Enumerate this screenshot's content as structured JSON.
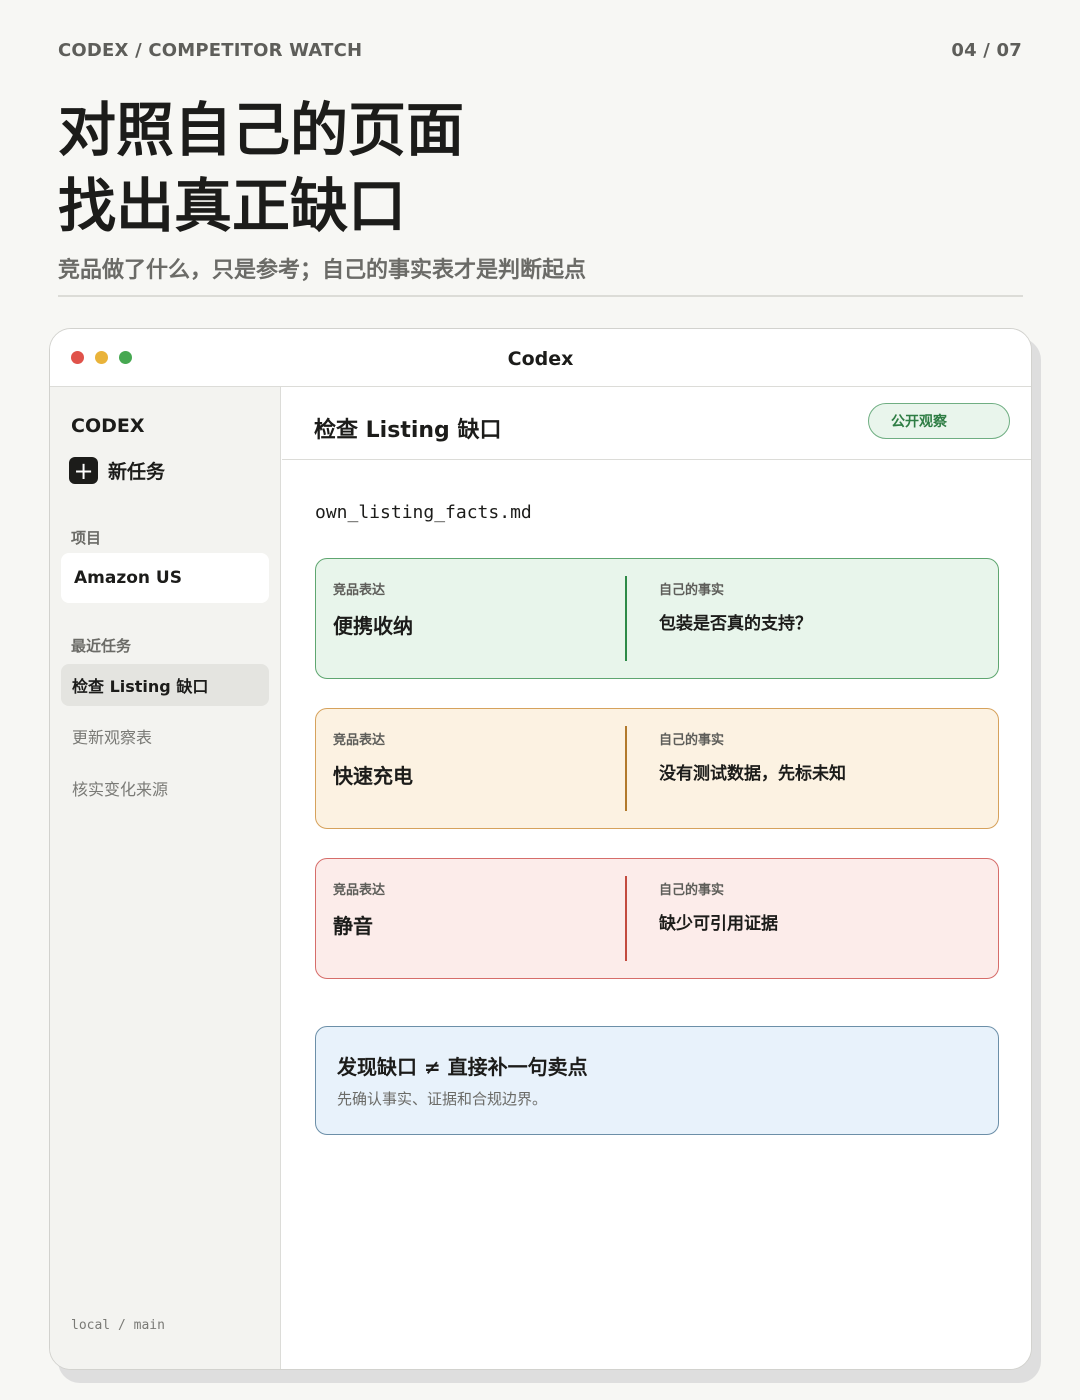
{
  "header": {
    "kicker": "CODEX / COMPETITOR WATCH",
    "page_indicator": "04 / 07",
    "headline_line1": "对照自己的页面",
    "headline_line2": "找出真正缺口",
    "subtitle": "竞品做了什么，只是参考；自己的事实表才是判断起点"
  },
  "window": {
    "title": "Codex"
  },
  "sidebar": {
    "brand": "CODEX",
    "new_task_label": "新任务",
    "projects_heading": "项目",
    "project": "Amazon US",
    "recent_heading": "最近任务",
    "tasks": [
      {
        "label": "检查 Listing 缺口",
        "active": true
      },
      {
        "label": "更新观察表",
        "active": false
      },
      {
        "label": "核实变化来源",
        "active": false
      }
    ],
    "branch": "local / main"
  },
  "main": {
    "title": "检查 Listing 缺口",
    "status": "公开观察",
    "filename": "own_listing_facts.md",
    "cards": [
      {
        "competitor_label": "竞品表达",
        "competitor_value": "便携收纳",
        "fact_label": "自己的事实",
        "fact_value": "包装是否真的支持？",
        "tone": "green"
      },
      {
        "competitor_label": "竞品表达",
        "competitor_value": "快速充电",
        "fact_label": "自己的事实",
        "fact_value": "没有测试数据，先标未知",
        "tone": "orange"
      },
      {
        "competitor_label": "竞品表达",
        "competitor_value": "静音",
        "fact_label": "自己的事实",
        "fact_value": "缺少可引用证据",
        "tone": "red"
      }
    ],
    "note": {
      "title": "发现缺口 ≠ 直接补一句卖点",
      "body": "先确认事实、证据和合规边界。"
    }
  },
  "colors": {
    "background": "#f7f7f4",
    "green_accent": "#2e8a47",
    "orange_accent": "#b27a2c",
    "red_accent": "#c34b3f",
    "note_background": "#e8f2fb"
  },
  "icons": {
    "new_task": "plus-icon"
  }
}
